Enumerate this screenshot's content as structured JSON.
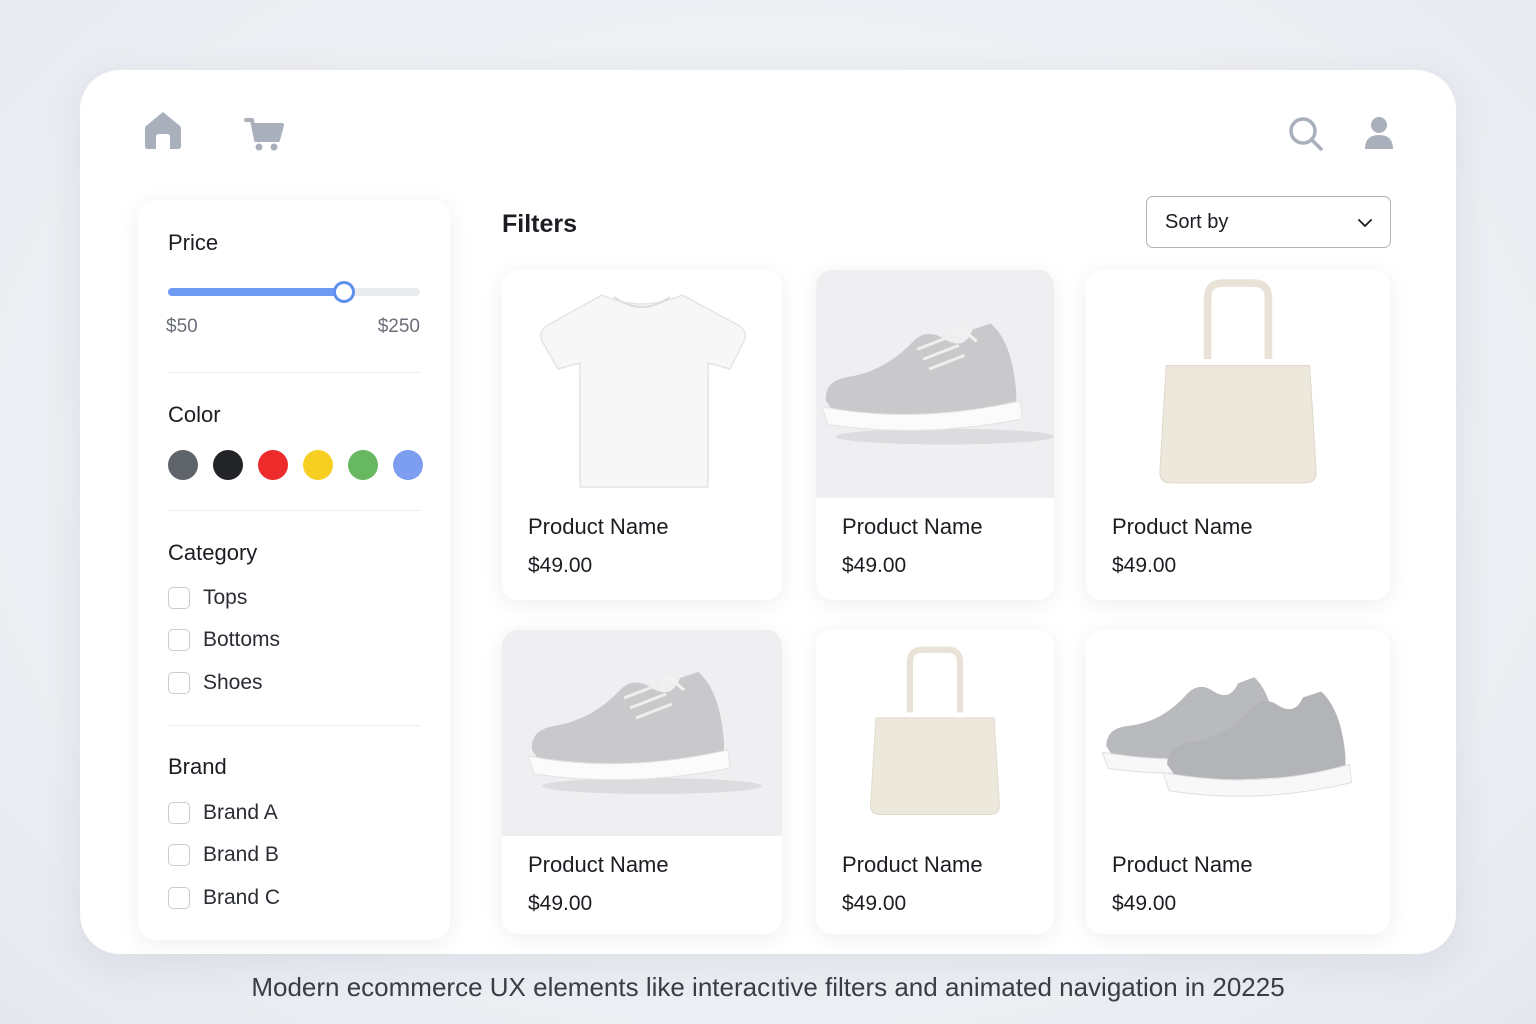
{
  "nav": {
    "home_icon": "home-icon",
    "cart_icon": "cart-icon",
    "search_icon": "search-icon",
    "user_icon": "user-icon",
    "icon_color": "#a9b0bc"
  },
  "sidebar": {
    "price": {
      "title": "Price",
      "min_label": "$50",
      "max_label": "$250",
      "slider_fraction": 0.7
    },
    "color": {
      "title": "Color",
      "swatches": [
        "#5f646b",
        "#232427",
        "#ee2b2b",
        "#f7cf22",
        "#67b860",
        "#7d9ef0"
      ]
    },
    "category": {
      "title": "Category",
      "items": [
        "Tops",
        "Bottoms",
        "Shoes"
      ]
    },
    "brand": {
      "title": "Brand",
      "items": [
        "Brand A",
        "Brand B",
        "Brand C"
      ]
    }
  },
  "main": {
    "title": "Filters",
    "sort_label": "Sort by",
    "products": [
      {
        "name": "Product Name",
        "price": "$49.00",
        "image": "t-shirt"
      },
      {
        "name": "Product Name",
        "price": "$49.00",
        "image": "sneaker"
      },
      {
        "name": "Product Name",
        "price": "$49.00",
        "image": "tote-bag"
      },
      {
        "name": "Product Name",
        "price": "$49.00",
        "image": "sneaker"
      },
      {
        "name": "Product Name",
        "price": "$49.00",
        "image": "tote-bag"
      },
      {
        "name": "Product Name",
        "price": "$49.00",
        "image": "sneaker-pair"
      }
    ]
  },
  "caption": "Modern ecommerce UX elements like interacıtive filters and animated navigation in 20225",
  "colors": {
    "accent": "#6b9af0",
    "background": "#eceef3"
  }
}
